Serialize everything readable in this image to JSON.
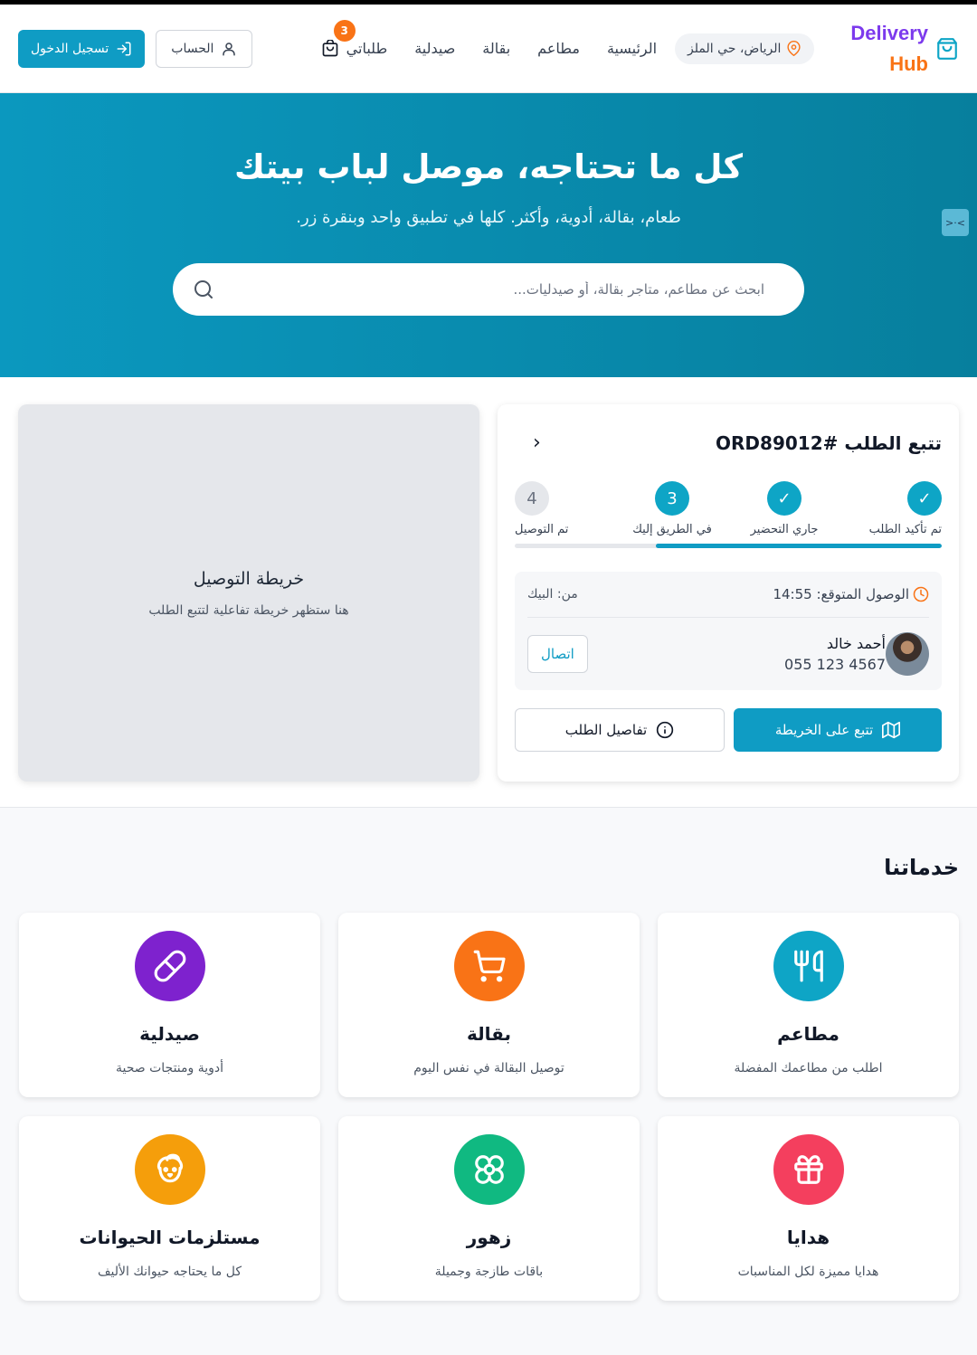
{
  "brand": {
    "line1": "Delivery",
    "line2": "Hub"
  },
  "header": {
    "location": "الرياض، حي الملز",
    "nav": [
      "الرئيسية",
      "مطاعم",
      "بقالة",
      "صيدلية"
    ],
    "orders_label": "طلباتي",
    "orders_count": "3",
    "account_label": "الحساب",
    "login_label": "تسجيل الدخول"
  },
  "hero": {
    "title": "كل ما تحتاجه، موصل لباب بيتك",
    "subtitle": "طعام، بقالة، أدوية، وأكثر. كلها في تطبيق واحد وبنقرة زر.",
    "search_placeholder": "ابحث عن مطاعم، متاجر بقالة، أو صيدليات..."
  },
  "tracking": {
    "title": "تتبع الطلب #ORD89012",
    "steps": [
      {
        "label": "تم تأكيد الطلب",
        "state": "done",
        "mark": "✓"
      },
      {
        "label": "جاري التحضير",
        "state": "done",
        "mark": "✓"
      },
      {
        "label": "في الطريق إليك",
        "state": "current",
        "mark": "3"
      },
      {
        "label": "تم التوصيل",
        "state": "todo",
        "mark": "4"
      }
    ],
    "progress_fraction": 0.67,
    "eta_label": "الوصول المتوقع: 14:55",
    "from_label": "من: البيك",
    "driver_name": "أحمد خالد",
    "driver_phone": "055 123 4567",
    "call_label": "اتصال",
    "track_map_label": "تتبع على الخريطة",
    "details_label": "تفاصيل الطلب"
  },
  "map": {
    "title": "خريطة التوصيل",
    "subtitle": "هنا ستظهر خريطة تفاعلية لتتبع الطلب"
  },
  "services": {
    "heading": "خدماتنا",
    "items": [
      {
        "name": "مطاعم",
        "desc": "اطلب من مطاعمك المفضلة",
        "color": "#0ea5c6",
        "icon": "utensils-icon"
      },
      {
        "name": "بقالة",
        "desc": "توصيل البقالة في نفس اليوم",
        "color": "#f97316",
        "icon": "cart-icon"
      },
      {
        "name": "صيدلية",
        "desc": "أدوية ومنتجات صحية",
        "color": "#7e22ce",
        "icon": "pill-icon"
      },
      {
        "name": "هدايا",
        "desc": "هدايا مميزة لكل المناسبات",
        "color": "#f43f5e",
        "icon": "gift-icon"
      },
      {
        "name": "زهور",
        "desc": "باقات طازجة وجميلة",
        "color": "#10b981",
        "icon": "flower-icon"
      },
      {
        "name": "مستلزمات الحيوانات",
        "desc": "كل ما يحتاجه حيوانك الأليف",
        "color": "#f59e0b",
        "icon": "pet-icon"
      }
    ]
  },
  "colors": {
    "primary": "#0f9cc4",
    "accent": "#f97316",
    "brand_purple": "#7c3aed"
  }
}
